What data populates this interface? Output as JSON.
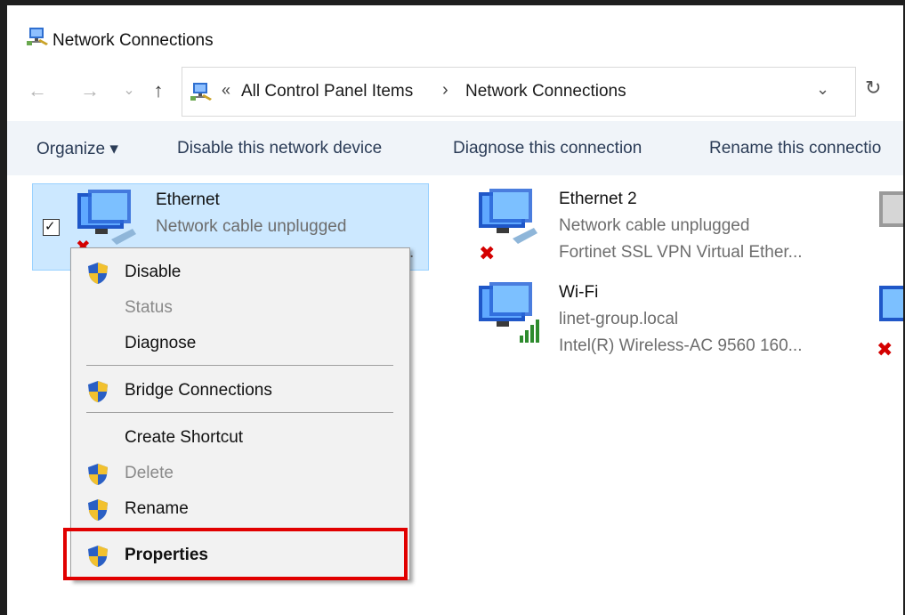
{
  "window": {
    "title": "Network Connections",
    "icon": "network-connections-icon"
  },
  "nav": {
    "back_icon": "←",
    "forward_icon": "→",
    "recent_icon": "⌄",
    "up_icon": "↑",
    "refresh_icon": "↻",
    "address": {
      "overflow": "«",
      "parts": [
        "All Control Panel Items",
        "Network Connections"
      ],
      "separator": "›",
      "dropdown": "⌄"
    }
  },
  "commands": [
    "Organize ▾",
    "Disable this network device",
    "Diagnose this connection",
    "Rename this connectio"
  ],
  "connections": [
    {
      "name": "Ethernet",
      "status": "Network cable unplugged",
      "device": ".",
      "selected": true,
      "checked": "✓",
      "error_icon": "✖"
    },
    {
      "name": "Ethernet 2",
      "status": "Network cable unplugged",
      "device": "Fortinet SSL VPN Virtual Ether...",
      "error_icon": "✖"
    },
    {
      "name": "Wi-Fi",
      "status": "linet-group.local",
      "device": "Intel(R) Wireless-AC 9560 160..."
    }
  ],
  "context_menu": {
    "items": [
      {
        "label": "Disable",
        "shield": true,
        "disabled": false
      },
      {
        "label": "Status",
        "shield": false,
        "disabled": true
      },
      {
        "label": "Diagnose",
        "shield": false,
        "disabled": false
      },
      {
        "label": "Bridge Connections",
        "shield": true,
        "disabled": false
      },
      {
        "label": "Create Shortcut",
        "shield": false,
        "disabled": false
      },
      {
        "label": "Delete",
        "shield": true,
        "disabled": true
      },
      {
        "label": "Rename",
        "shield": true,
        "disabled": false
      },
      {
        "label": "Properties",
        "shield": true,
        "disabled": false,
        "bold": true
      }
    ]
  },
  "colors": {
    "selection": "#cce8ff",
    "annotation": "#e10000",
    "command_bar": "#f0f4f9"
  }
}
